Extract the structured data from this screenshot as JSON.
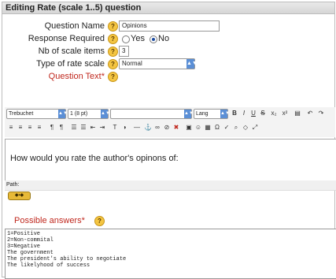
{
  "section": {
    "title": "Editing Rate (scale 1..5) question"
  },
  "form": {
    "question_name": {
      "label": "Question Name",
      "value": "Opinions"
    },
    "response_required": {
      "label": "Response Required",
      "options": [
        "Yes",
        "No"
      ],
      "selected": "No"
    },
    "nb_scale_items": {
      "label": "Nb of scale items",
      "value": "3"
    },
    "type_of_rate_scale": {
      "label": "Type of rate scale",
      "value": "Normal"
    },
    "question_text": {
      "label": "Question Text*"
    }
  },
  "editor": {
    "font": "Trebuchet",
    "size": "1 (8 pt)",
    "lang": "Lang",
    "content": "How would you rate the author's opinons of:",
    "path_label": "Path:"
  },
  "possible_answers": {
    "label": "Possible answers*",
    "lines": [
      "1=Positive",
      "2=Non-commital",
      "3=Negative",
      "The government",
      "The president's ability to negotiate",
      "The likelyhood of success"
    ]
  },
  "icons": {
    "help": "question-mark-help-icon",
    "toolbar": [
      "bold",
      "italic",
      "underline",
      "strikethrough",
      "subscript",
      "superscript",
      "paste",
      "undo",
      "align-left",
      "align-center",
      "align-right",
      "justify",
      "ltr",
      "rtl",
      "ordered-list",
      "unordered-list",
      "outdent",
      "indent",
      "text-color",
      "background-color",
      "horizontal-rule",
      "anchor",
      "link",
      "unlink",
      "no-link",
      "image",
      "smiley",
      "insert-table",
      "special-char",
      "spell",
      "html-source"
    ]
  },
  "colors": {
    "accent": "#c0281e",
    "help": "#f4c542",
    "select_arrow": "#5b8fd6"
  }
}
